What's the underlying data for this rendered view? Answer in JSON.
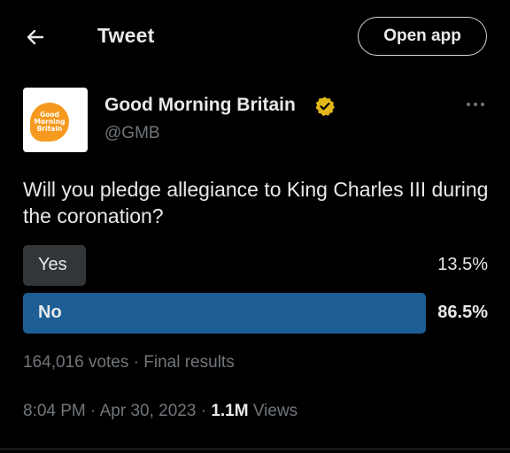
{
  "header": {
    "back_icon": "arrow-left-icon",
    "title": "Tweet",
    "open_app_label": "Open app"
  },
  "author": {
    "avatar_logo_lines": [
      "Good",
      "Morning",
      "Britain"
    ],
    "avatar_color": "#f59a1e",
    "name": "Good Morning Britain",
    "verified_icon": "verified-badge-icon",
    "verified_color": "#e2b719",
    "handle": "@GMB",
    "more_icon": "more-dots-icon"
  },
  "tweet": {
    "text": "Will you pledge allegiance to King Charles III during the coronation?"
  },
  "poll": {
    "options": [
      {
        "label": "Yes",
        "percent": "13.5%",
        "share": 13.5,
        "winner": false
      },
      {
        "label": "No",
        "percent": "86.5%",
        "share": 86.5,
        "winner": true
      }
    ],
    "votes": "164,016 votes",
    "separator": "·",
    "status": "Final results",
    "winner_color": "#1d5e94",
    "loser_color": "#333639"
  },
  "meta": {
    "time": "8:04 PM",
    "date": "Apr 30, 2023",
    "separator": "·",
    "views_count": "1.1M",
    "views_label": "Views"
  }
}
